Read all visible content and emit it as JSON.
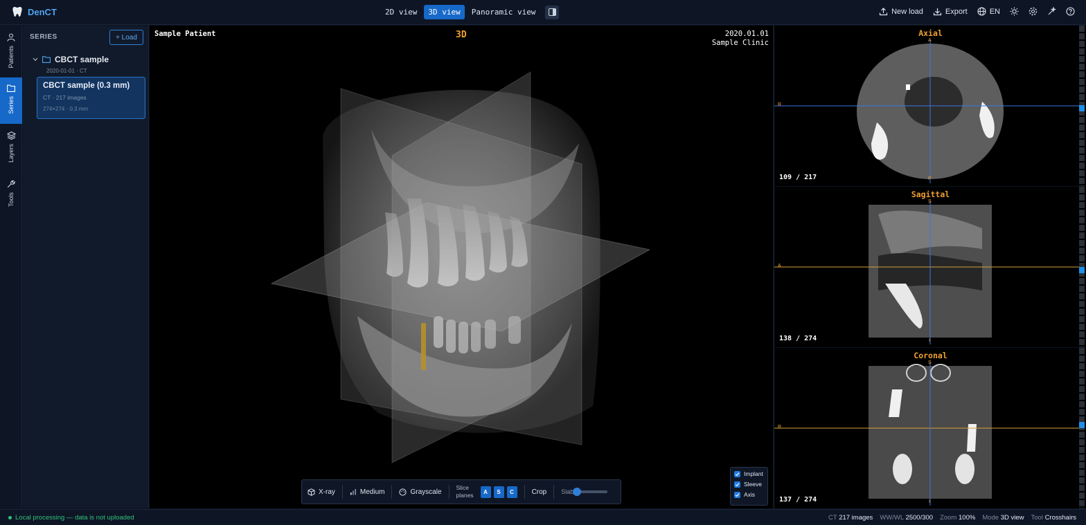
{
  "app": {
    "name": "DenCT"
  },
  "view_tabs": [
    {
      "label": "2D view",
      "active": false
    },
    {
      "label": "3D view",
      "active": true
    },
    {
      "label": "Panoramic view",
      "active": false
    }
  ],
  "top_actions": {
    "new_load": "New load",
    "export": "Export",
    "language": "EN"
  },
  "rail": {
    "patients": "Patients",
    "series": "Series",
    "layers": "Layers",
    "tools": "Tools"
  },
  "series_panel": {
    "heading": "SERIES",
    "load_label": "+ Load",
    "group": {
      "name": "CBCT sample",
      "meta": "2020-01-01 · CT"
    },
    "card": {
      "title": "CBCT sample (0.3 mm)",
      "line1": "CT · 217 images",
      "line2": "274×274 · 0.3 mm"
    }
  },
  "viewport": {
    "patient": "Sample Patient",
    "mode_label": "3D",
    "date": "2020.01.01",
    "clinic": "Sample Clinic",
    "toolbar": {
      "xray": "X-ray",
      "medium": "Medium",
      "grayscale": "Grayscale",
      "slice_planes_1": "Slice",
      "slice_planes_2": "planes",
      "plane_a": "A",
      "plane_s": "S",
      "plane_c": "C",
      "crop": "Crop",
      "slab": "Slab",
      "slab_value": 0.0
    },
    "checks": {
      "implant": "Implant",
      "sleeve": "Sleeve",
      "axis": "Axis"
    }
  },
  "panes": {
    "axial": {
      "title": "Axial",
      "count": "109 / 217",
      "orient_top": "A",
      "orient_bottom": "P",
      "orient_left": "R",
      "orient_right": "L"
    },
    "sagittal": {
      "title": "Sagittal",
      "count": "138 / 274",
      "orient_top": "S",
      "orient_bottom": "I",
      "orient_left": "A",
      "orient_right": "P"
    },
    "coronal": {
      "title": "Coronal",
      "count": "137 / 274",
      "orient_top": "S",
      "orient_bottom": "I",
      "orient_left": "R",
      "orient_right": "L"
    }
  },
  "status": {
    "local": "Local processing — data is not uploaded",
    "ct_label": "CT",
    "ct_value": "217 images",
    "wwwl_label": "WW/WL",
    "wwwl_value": "2500/300",
    "zoom_label": "Zoom",
    "zoom_value": "100%",
    "mode_label": "Mode",
    "mode_value": "3D view",
    "tool_label": "Tool",
    "tool_value": "Crosshairs"
  },
  "colors": {
    "accent": "#1769c9",
    "orange": "#f0a030",
    "status_green": "#31c27b"
  }
}
